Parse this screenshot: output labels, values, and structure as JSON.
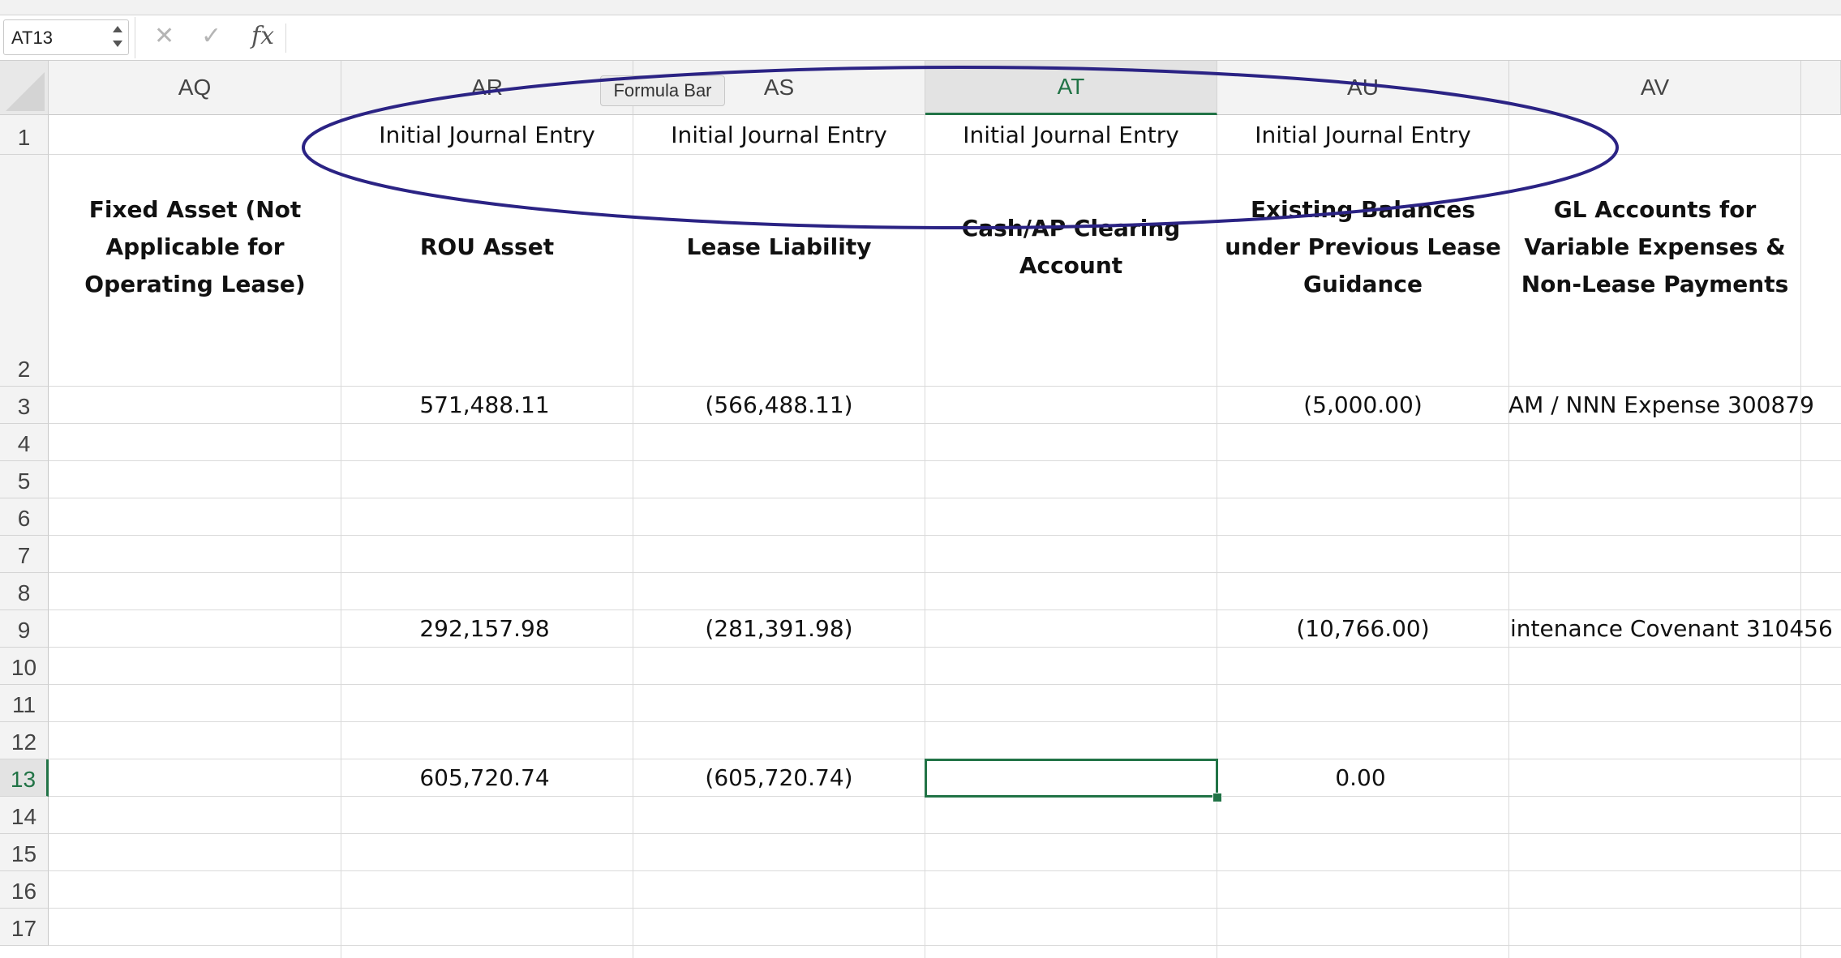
{
  "formula_bar": {
    "name_box": "AT13",
    "cancel_icon": "close-icon",
    "enter_icon": "checkmark-icon",
    "function_label": "fx",
    "formula_value": ""
  },
  "tooltip": {
    "label": "Formula Bar"
  },
  "columns": [
    "AQ",
    "AR",
    "AS",
    "AT",
    "AU",
    "AV"
  ],
  "selected_column": "AT",
  "rows": [
    "1",
    "2",
    "3",
    "4",
    "5",
    "6",
    "7",
    "8",
    "9",
    "10",
    "11",
    "12",
    "13",
    "14",
    "15",
    "16",
    "17"
  ],
  "selected_row": "13",
  "row1": [
    "",
    "Initial Journal Entry",
    "Initial Journal Entry",
    "Initial Journal Entry",
    "Initial Journal Entry",
    ""
  ],
  "row2": [
    "Fixed Asset (Not Applicable for Operating Lease)",
    "ROU Asset",
    "Lease Liability",
    "Cash/AP Clearing Account",
    "Existing Balances under Previous Lease Guidance",
    "GL Accounts for Variable Expenses & Non-Lease Payments"
  ],
  "row3": [
    "",
    "571,488.11",
    "(566,488.11)",
    "",
    "(5,000.00)",
    "AM / NNN Expense  300879"
  ],
  "row9": [
    "",
    "292,157.98",
    "(281,391.98)",
    "",
    "(10,766.00)",
    "intenance Covenant  310456"
  ],
  "row13": [
    "",
    "605,720.74",
    "(605,720.74)",
    "",
    "0.00",
    ""
  ],
  "colors": {
    "selection_green": "#217346",
    "annotation_ellipse": "#2b2384"
  }
}
